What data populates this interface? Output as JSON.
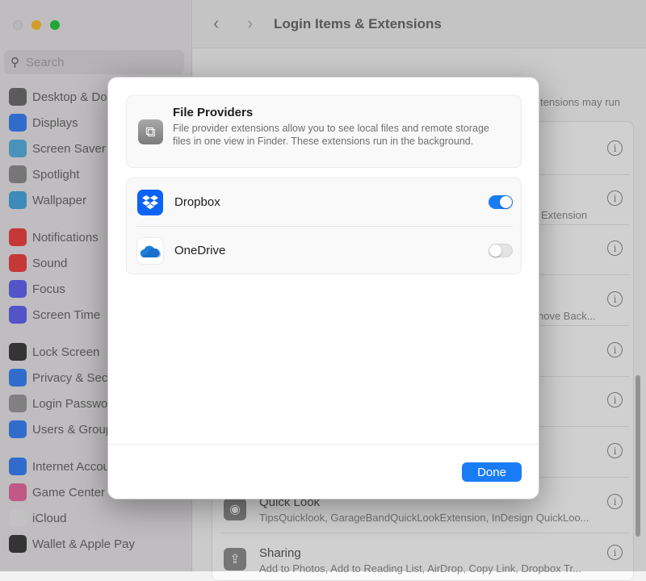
{
  "sidebar": {
    "search_placeholder": "Search",
    "items": [
      {
        "label": "Desktop & Dock",
        "icon": "desktop-dock-icon",
        "color": "#6e6e6e"
      },
      {
        "label": "Displays",
        "icon": "displays-icon",
        "color": "#3b82f6"
      },
      {
        "label": "Screen Saver",
        "icon": "screen-saver-icon",
        "color": "#5ab0e0"
      },
      {
        "label": "Spotlight",
        "icon": "spotlight-icon",
        "color": "#8e8e8e"
      },
      {
        "label": "Wallpaper",
        "icon": "wallpaper-icon",
        "color": "#4aa8e0"
      },
      {
        "label": "Notifications",
        "icon": "notifications-icon",
        "color": "#ef4444"
      },
      {
        "label": "Sound",
        "icon": "sound-icon",
        "color": "#ef4444"
      },
      {
        "label": "Focus",
        "icon": "focus-icon",
        "color": "#6366f1"
      },
      {
        "label": "Screen Time",
        "icon": "screen-time-icon",
        "color": "#6366f1"
      },
      {
        "label": "Lock Screen",
        "icon": "lock-screen-icon",
        "color": "#3f3f3f"
      },
      {
        "label": "Privacy & Security",
        "icon": "privacy-icon",
        "color": "#3b82f6"
      },
      {
        "label": "Login Password",
        "icon": "login-password-icon",
        "color": "#9a9a9a"
      },
      {
        "label": "Users & Groups",
        "icon": "users-groups-icon",
        "color": "#3b82f6"
      },
      {
        "label": "Internet Accounts",
        "icon": "internet-accounts-icon",
        "color": "#3b82f6"
      },
      {
        "label": "Game Center",
        "icon": "game-center-icon",
        "color": "#e86ba0"
      },
      {
        "label": "iCloud",
        "icon": "icloud-icon",
        "color": "#e8e8e8"
      },
      {
        "label": "Wallet & Apple Pay",
        "icon": "wallet-icon",
        "color": "#3f3f3f"
      }
    ]
  },
  "header": {
    "title": "Login Items & Extensions",
    "back": "‹",
    "forward": "›"
  },
  "background": {
    "fragment_1": "tensions may run",
    "fragment_2": "Extension",
    "fragment_3": "nove Back...",
    "rows": [
      {
        "title": "Quick Look",
        "subtitle": "TipsQuicklook, GarageBandQuickLookExtension, InDesign QuickLoo..."
      },
      {
        "title": "Sharing",
        "subtitle": "Add to Photos, Add to Reading List, AirDrop, Copy Link, Dropbox Tr..."
      }
    ]
  },
  "modal": {
    "title": "File Providers",
    "description": "File provider extensions allow you to see local files and remote storage files in one view in Finder. These extensions run in the background.",
    "providers": [
      {
        "name": "Dropbox",
        "enabled": true
      },
      {
        "name": "OneDrive",
        "enabled": false
      }
    ],
    "done_label": "Done"
  },
  "colors": {
    "accent": "#1a7cf5",
    "dropbox": "#0d63f3",
    "onedrive": "#1e7fd6"
  }
}
